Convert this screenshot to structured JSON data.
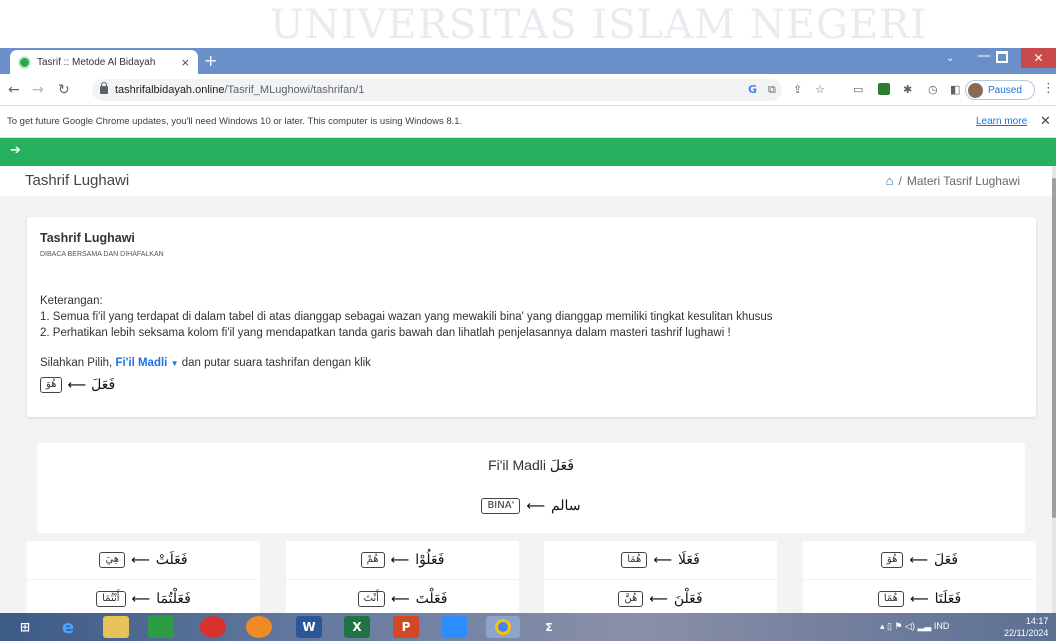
{
  "wallpaper": {
    "text": "UNIVERSITAS ISLAM NEGERI"
  },
  "browser": {
    "tab_title": "Tasrif :: Metode Al Bidayah",
    "tab_close": "×",
    "new_tab": "+",
    "url_host": "tashrifalbidayah.online",
    "url_path": "/Tasrif_MLughowi/tashrifan/1",
    "profile_label": "Paused"
  },
  "infobar": {
    "message": "To get future Google Chrome updates, you'll need Windows 10 or later. This computer is using Windows 8.1.",
    "link": "Learn more",
    "close": "✕"
  },
  "page": {
    "title": "Tashrif Lughawi",
    "breadcrumb_current": "Materi Tasrif Lughawi",
    "breadcrumb_sep": "/",
    "card": {
      "title": "Tashrif Lughawi",
      "subtitle": "DIBACA BERSAMA DAN DIHAFALKAN",
      "keterangan_title": "Keterangan:",
      "note1": "1. Semua fi'il yang terdapat di dalam tabel di atas dianggap sebagai wazan yang mewakili bina' yang dianggap memiliki tingkat kesulitan khusus",
      "note2": "2. Perhatikan lebih seksama kolom fi'il yang mendapatkan tanda garis bawah dan lihatlah penjelasannya dalam masteri tashrif lughawi !",
      "pilih_prefix": "Silahkan Pilih,",
      "dropdown_label": "Fi'il Madli",
      "pilih_suffix": "dan putar suara tashrifan dengan klik",
      "example_pron": "هُوَ",
      "example_verb": "فَعَلَ"
    },
    "table_header": {
      "title_latin": "Fi'il Madli",
      "title_arab": "فَعَلَ",
      "bina_label": "BINA'",
      "bina_value": "سالم"
    },
    "cells": [
      {
        "pron": "هِيَ",
        "verb": "فَعَلَتْ"
      },
      {
        "pron": "هُمْ",
        "verb": "فَعَلُوْا"
      },
      {
        "pron": "هُمَا",
        "verb": "فَعَلَا"
      },
      {
        "pron": "هُوَ",
        "verb": "فَعَلَ"
      },
      {
        "pron": "أَنْتُمَا",
        "verb": "فَعَلْتُمَا"
      },
      {
        "pron": "أَنْتَ",
        "verb": "فَعَلْتَ"
      },
      {
        "pron": "هُنَّ",
        "verb": "فَعَلْنَ"
      },
      {
        "pron": "هُمَا",
        "verb": "فَعَلَتَا"
      }
    ]
  },
  "taskbar": {
    "language": "IND",
    "time": "14:17",
    "date": "22/11/2024"
  }
}
